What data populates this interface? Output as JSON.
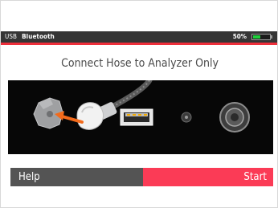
{
  "status_bar": {
    "usb_label": "USB",
    "bluetooth_label": "Bluetooth",
    "battery_percent": "50%",
    "battery_level": 0.5,
    "battery_color": "#1fd03a"
  },
  "instruction": "Connect Hose to Analyzer Only",
  "illustration": {
    "icons": [
      "hose-connector-icon",
      "hose-plug-icon",
      "usb-port-icon",
      "small-port-icon",
      "round-port-icon",
      "arrow-icon"
    ],
    "arrow_color": "#f26a1b"
  },
  "buttons": {
    "help_label": "Help",
    "start_label": "Start"
  },
  "colors": {
    "accent_red": "#ee2f3b",
    "start_button": "#fb3b56",
    "help_button": "#545454",
    "status_bar": "#353535"
  }
}
